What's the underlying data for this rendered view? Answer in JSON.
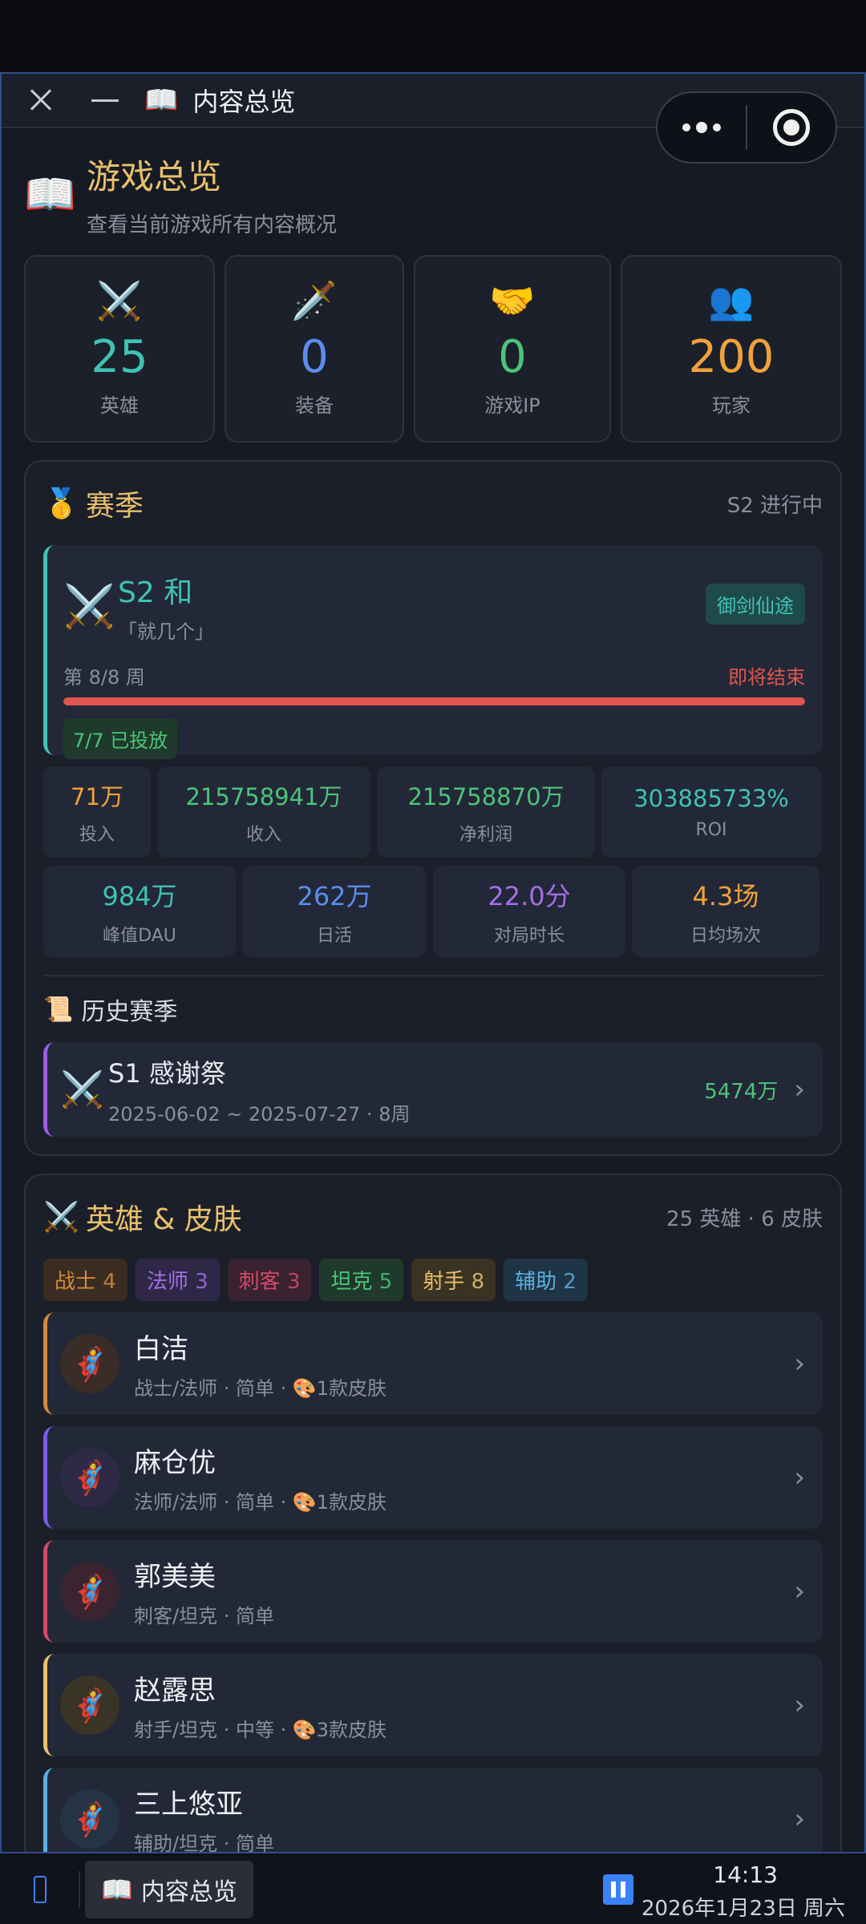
{
  "window": {
    "title": "内容总览",
    "title_icon": "book-icon"
  },
  "header": {
    "title": "游戏总览",
    "subtitle": "查看当前游戏所有内容概况",
    "icon": "book-icon"
  },
  "stats": [
    {
      "icon": "crossed-swords-icon",
      "glyph": "⚔️",
      "value": "25",
      "label": "英雄",
      "color": "#3fc3b4"
    },
    {
      "icon": "dagger-icon",
      "glyph": "🗡️",
      "value": "0",
      "label": "装备",
      "color": "#5b8def"
    },
    {
      "icon": "handshake-icon",
      "glyph": "🤝",
      "value": "0",
      "label": "游戏IP",
      "color": "#4cc47a"
    },
    {
      "icon": "users-icon",
      "glyph": "👥",
      "value": "200",
      "label": "玩家",
      "color": "#f0a23b"
    }
  ],
  "season": {
    "title": "赛季",
    "status": "S2 进行中",
    "current": {
      "name": "S2 和",
      "subtitle": "「就几个」",
      "tag": "御剑仙途",
      "week": "第 8/8 周",
      "ending": "即将结束",
      "progress": 1.0,
      "release": "7/7 已投放"
    },
    "metrics_row1": [
      {
        "value": "71万",
        "label": "投入",
        "color": "#f0a23b"
      },
      {
        "value": "215758941万",
        "label": "收入",
        "color": "#4cc47a"
      },
      {
        "value": "215758870万",
        "label": "净利润",
        "color": "#4cc47a"
      },
      {
        "value": "303885733%",
        "label": "ROI",
        "color": "#3fc3b4"
      }
    ],
    "metrics_row2": [
      {
        "value": "984万",
        "label": "峰值DAU",
        "color": "#3fc3b4"
      },
      {
        "value": "262万",
        "label": "日活",
        "color": "#5b8def"
      },
      {
        "value": "22.0分",
        "label": "对局时长",
        "color": "#a46ee8"
      },
      {
        "value": "4.3场",
        "label": "日均场次",
        "color": "#f0a23b"
      }
    ],
    "history_title": "历史赛季",
    "history": [
      {
        "name": "S1 感谢祭",
        "dates": "2025-06-02 ~ 2025-07-27 · 8周",
        "value": "5474万"
      }
    ]
  },
  "heroes": {
    "title": "英雄 & 皮肤",
    "summary": "25 英雄 · 6 皮肤",
    "roles": [
      {
        "label": "战士",
        "count": "4",
        "fg": "#d48a3a",
        "bg": "#3a2c22"
      },
      {
        "label": "法师",
        "count": "3",
        "fg": "#a46ee8",
        "bg": "#2e2846"
      },
      {
        "label": "刺客",
        "count": "3",
        "fg": "#d64a6a",
        "bg": "#3a2230"
      },
      {
        "label": "坦克",
        "count": "5",
        "fg": "#4cc47a",
        "bg": "#1f3a2c"
      },
      {
        "label": "射手",
        "count": "8",
        "fg": "#e9c16b",
        "bg": "#3a3222"
      },
      {
        "label": "辅助",
        "count": "2",
        "fg": "#5bb0e0",
        "bg": "#1f3444"
      }
    ],
    "list": [
      {
        "name": "白洁",
        "meta": "战士/法师 · 简单 · ",
        "skins": "1款皮肤",
        "border": "#d48a3a",
        "avbg": "#3a2c26"
      },
      {
        "name": "麻仓优",
        "meta": "法师/法师 · 简单 · ",
        "skins": "1款皮肤",
        "border": "#7b5de5",
        "avbg": "#2e2a46"
      },
      {
        "name": "郭美美",
        "meta": "刺客/坦克 · 简单",
        "skins": "",
        "border": "#d64a6a",
        "avbg": "#3a2430"
      },
      {
        "name": "赵露思",
        "meta": "射手/坦克 · 中等 · ",
        "skins": "3款皮肤",
        "border": "#e9c16b",
        "avbg": "#3a3426"
      },
      {
        "name": "三上悠亚",
        "meta": "辅助/坦克 · 简单",
        "skins": "",
        "border": "#5bb0e0",
        "avbg": "#243444"
      }
    ]
  },
  "taskbar": {
    "app_label": "内容总览",
    "time": "14:13",
    "date": "2026年1月23日 周六"
  }
}
